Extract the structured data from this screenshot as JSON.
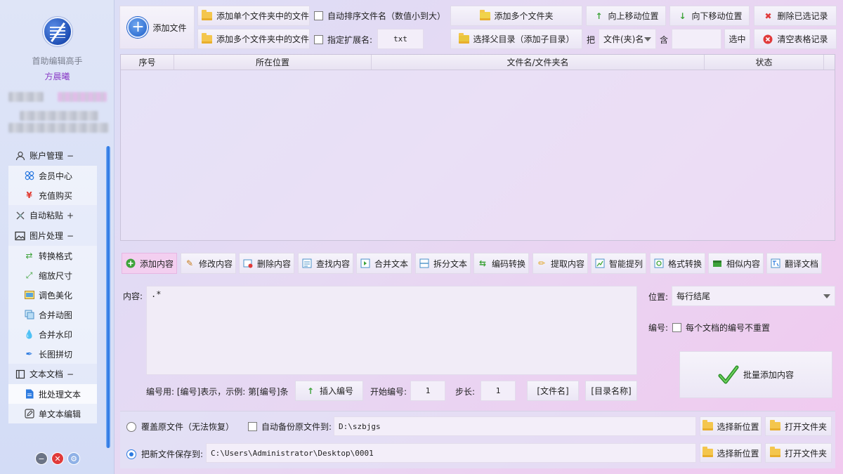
{
  "sidebar": {
    "app_name": "首助编辑高手",
    "user_name": "方晨曦",
    "groups": [
      {
        "label": "账户管理",
        "toggle": "−",
        "icon": "user-icon"
      },
      {
        "label": "自动粘贴",
        "toggle": "+",
        "icon": "paste-icon"
      },
      {
        "label": "图片处理",
        "toggle": "−",
        "icon": "image-icon"
      },
      {
        "label": "文本文档",
        "toggle": "−",
        "icon": "document-icon"
      }
    ],
    "account_items": [
      {
        "label": "会员中心",
        "icon": "member-icon"
      },
      {
        "label": "充值购买",
        "icon": "yen-icon"
      }
    ],
    "image_items": [
      {
        "label": "转换格式",
        "icon": "convert-icon"
      },
      {
        "label": "缩放尺寸",
        "icon": "resize-icon"
      },
      {
        "label": "调色美化",
        "icon": "palette-icon"
      },
      {
        "label": "合并动图",
        "icon": "gif-icon"
      },
      {
        "label": "合并水印",
        "icon": "watermark-icon"
      },
      {
        "label": "长图拼切",
        "icon": "pen-icon"
      }
    ],
    "text_items": [
      {
        "label": "批处理文本",
        "icon": "batch-text-icon"
      },
      {
        "label": "单文本编辑",
        "icon": "edit-text-icon"
      }
    ]
  },
  "toolbar": {
    "add_file": "添加文件",
    "add_single_folder": "添加单个文件夹中的文件",
    "add_multi_folder_files": "添加多个文件夹中的文件",
    "auto_sort": "自动排序文件名（数值小到大）",
    "specify_ext": "指定扩展名:",
    "ext_value": "txt",
    "add_multi_folders": "添加多个文件夹",
    "select_parent": "选择父目录（添加子目录）",
    "move_up": "向上移动位置",
    "move_down": "向下移动位置",
    "delete_selected": "删除已选记录",
    "clear_table": "清空表格记录",
    "ba": "把",
    "filter_field": "文件(夹)名",
    "contains": "含",
    "filter_value": "",
    "select_btn": "选中"
  },
  "table": {
    "columns": [
      "序号",
      "所在位置",
      "文件名/文件夹名",
      "状态"
    ],
    "rows": []
  },
  "tools": [
    {
      "label": "添加内容",
      "icon": "add-content-icon"
    },
    {
      "label": "修改内容",
      "icon": "modify-content-icon"
    },
    {
      "label": "删除内容",
      "icon": "delete-content-icon"
    },
    {
      "label": "查找内容",
      "icon": "find-content-icon"
    },
    {
      "label": "合并文本",
      "icon": "merge-text-icon"
    },
    {
      "label": "拆分文本",
      "icon": "split-text-icon"
    },
    {
      "label": "编码转换",
      "icon": "encoding-icon"
    },
    {
      "label": "提取内容",
      "icon": "extract-icon"
    },
    {
      "label": "智能提列",
      "icon": "smart-column-icon"
    },
    {
      "label": "格式转换",
      "icon": "format-convert-icon"
    },
    {
      "label": "相似内容",
      "icon": "similar-icon"
    },
    {
      "label": "翻译文档",
      "icon": "translate-icon"
    }
  ],
  "editor": {
    "content_label": "内容:",
    "content_value": ".*",
    "position_label": "位置:",
    "position_value": "每行结尾",
    "number_label": "编号:",
    "number_unique": "每个文档的编号不重置",
    "number_hint": "编号用: [编号]表示，示例: 第[编号]条",
    "insert_number": "插入编号",
    "start_label": "开始编号:",
    "start_value": "1",
    "step_label": "步长:",
    "step_value": "1",
    "file_name_token": "[文件名]",
    "dir_name_token": "[目录名称]",
    "batch_add": "批量添加内容"
  },
  "output": {
    "overwrite": "覆盖原文件（无法恢复）",
    "auto_backup": "自动备份原文件到:",
    "backup_path": "D:\\szbjgs",
    "save_new": "把新文件保存到:",
    "save_path": "C:\\Users\\Administrator\\Desktop\\0001",
    "choose_location": "选择新位置",
    "open_folder": "打开文件夹"
  }
}
